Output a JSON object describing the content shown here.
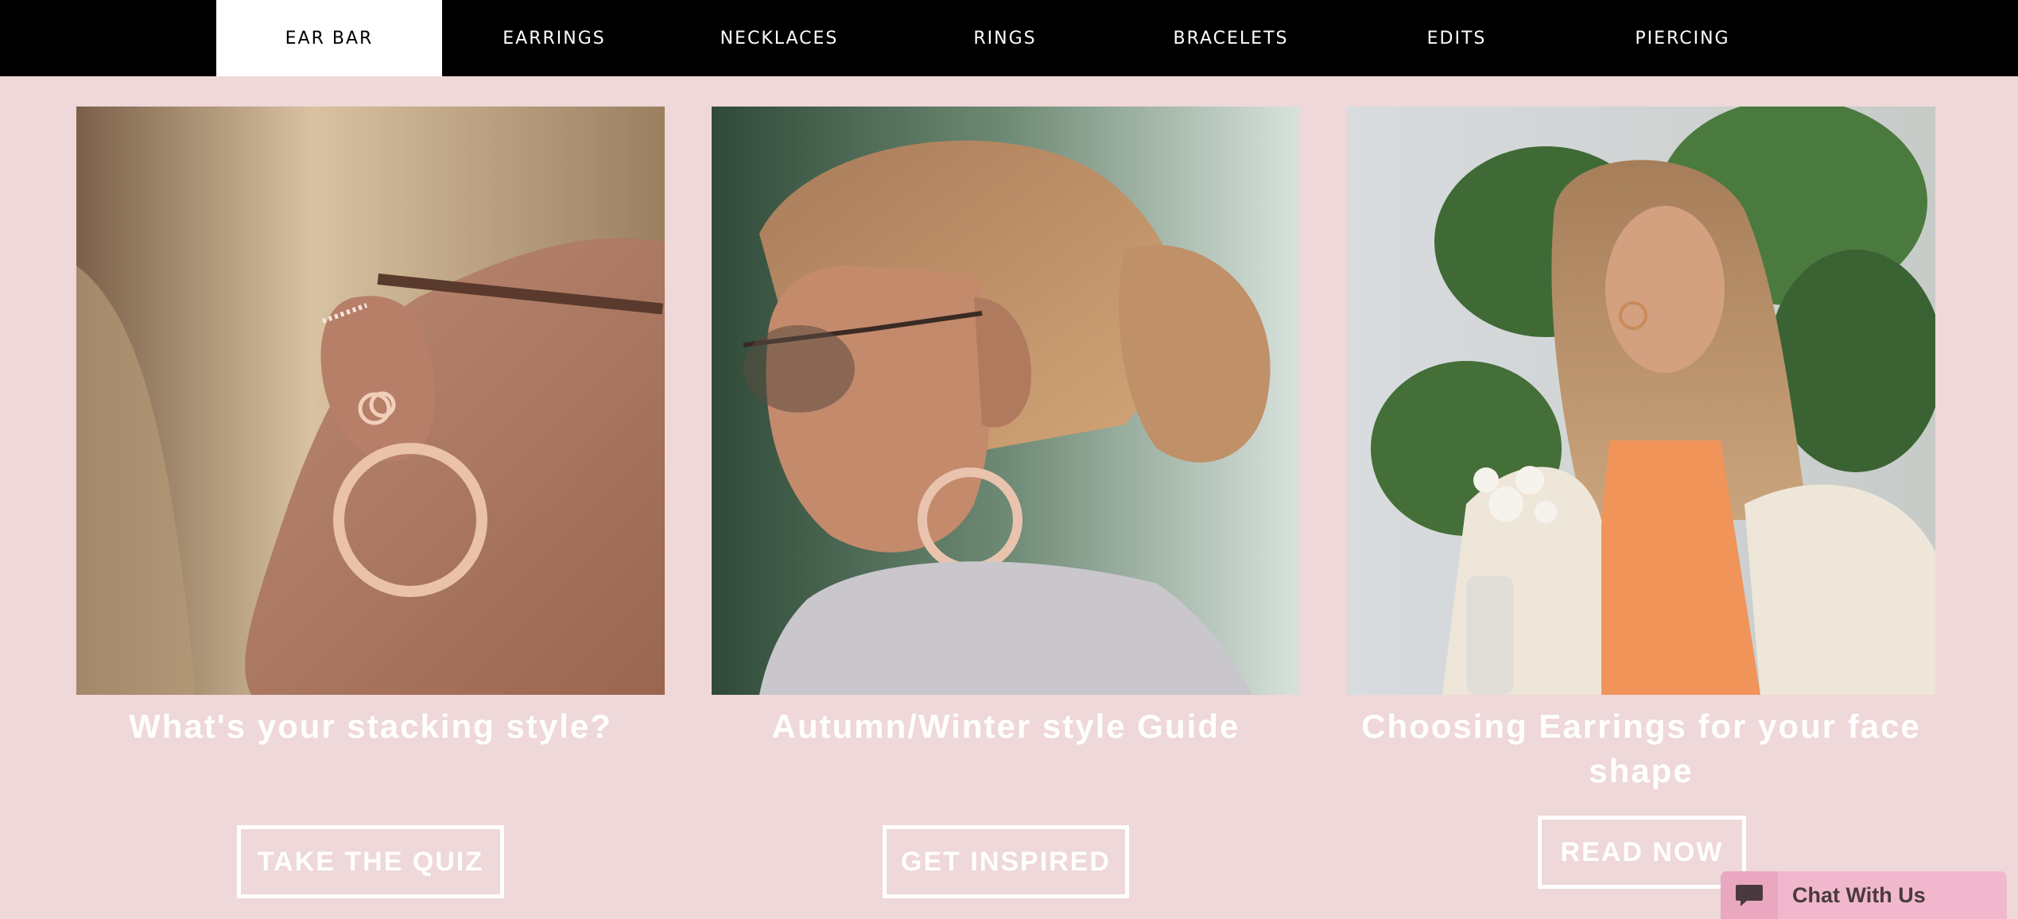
{
  "nav": {
    "items": [
      {
        "label": "EAR BAR",
        "active": true
      },
      {
        "label": "EARRINGS",
        "active": false
      },
      {
        "label": "NECKLACES",
        "active": false
      },
      {
        "label": "RINGS",
        "active": false
      },
      {
        "label": "BRACELETS",
        "active": false
      },
      {
        "label": "EDITS",
        "active": false
      },
      {
        "label": "PIERCING",
        "active": false
      }
    ]
  },
  "cards": [
    {
      "title": "What's your stacking style?",
      "button_label": "TAKE THE QUIZ"
    },
    {
      "title": "Autumn/Winter style Guide",
      "button_label": "GET INSPIRED"
    },
    {
      "title": "Choosing Earrings for your face shape",
      "button_label": "READ NOW"
    }
  ],
  "chat": {
    "label": "Chat With Us",
    "icon": "chat-bubble-icon"
  },
  "colors": {
    "page_background": "#efd8d9",
    "nav_background": "#000000",
    "nav_active_background": "#ffffff",
    "chat_background": "#f1b8cd"
  }
}
